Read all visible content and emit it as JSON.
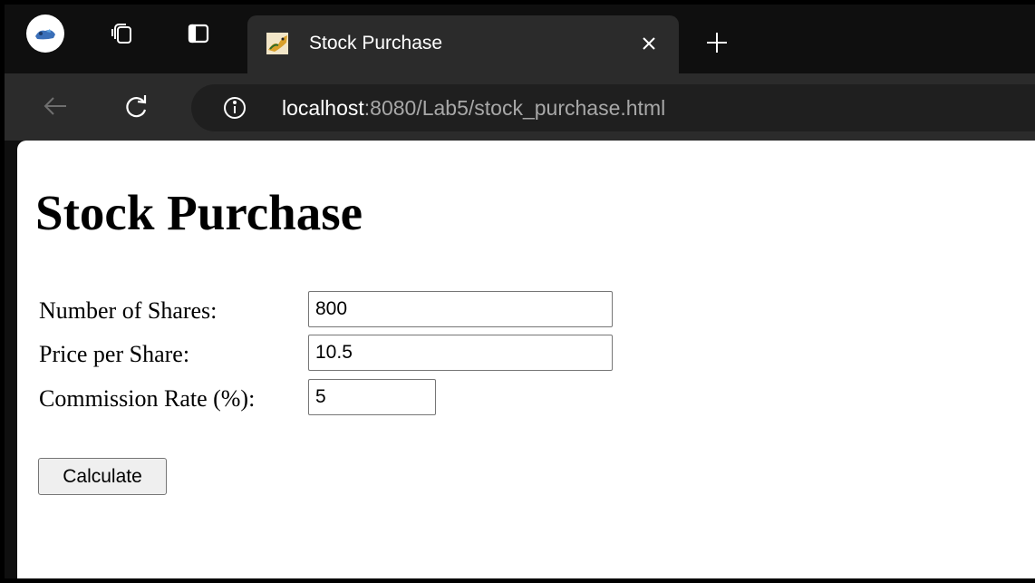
{
  "browser": {
    "tab": {
      "title": "Stock Purchase"
    },
    "address_bar": {
      "host": "localhost",
      "path": ":8080/Lab5/stock_purchase.html"
    },
    "icons": {
      "profile": "profile-avatar-icon",
      "workspaces": "workspaces-icon",
      "vertical_tabs": "vertical-tabs-icon",
      "favicon": "tomcat-favicon-icon",
      "close": "close-icon",
      "new_tab": "plus-icon",
      "back": "back-arrow-icon",
      "refresh": "refresh-icon",
      "info": "info-icon"
    },
    "colors": {
      "tabstrip_bg": "#0f0f0f",
      "toolbar_bg": "#2b2b2b",
      "omnibox_bg": "#1f1f1f"
    }
  },
  "page": {
    "title": "Stock Purchase",
    "form": {
      "shares_label": "Number of Shares:",
      "shares_value": "800",
      "price_label": "Price per Share:",
      "price_value": "10.5",
      "commission_label": "Commission Rate (%):",
      "commission_value": "5",
      "submit_label": "Calculate"
    }
  }
}
